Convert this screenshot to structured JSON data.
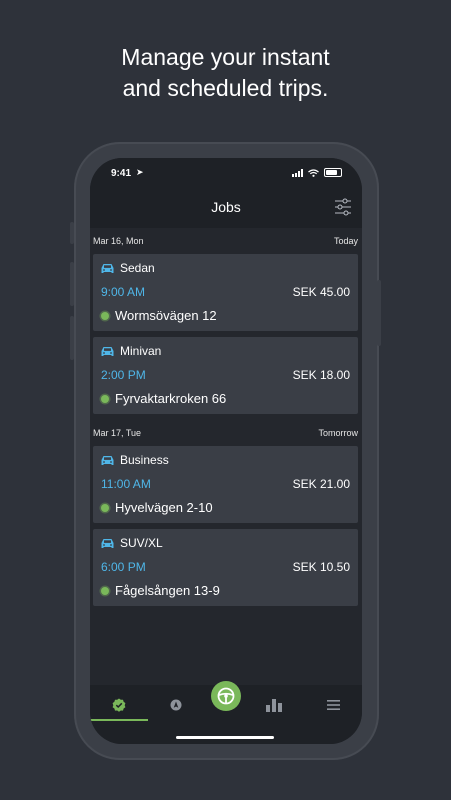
{
  "headline": {
    "line1": "Manage your instant",
    "line2": "and scheduled trips."
  },
  "status_bar": {
    "time": "9:41"
  },
  "nav": {
    "title": "Jobs"
  },
  "sections": [
    {
      "date": "Mar 16, Mon",
      "relative": "Today",
      "jobs": [
        {
          "vehicle": "Sedan",
          "time": "9:00 AM",
          "price": "SEK 45.00",
          "address": "Wormsövägen 12"
        },
        {
          "vehicle": "Minivan",
          "time": "2:00 PM",
          "price": "SEK 18.00",
          "address": "Fyrvaktarkroken 66"
        }
      ]
    },
    {
      "date": "Mar 17, Tue",
      "relative": "Tomorrow",
      "jobs": [
        {
          "vehicle": "Business",
          "time": "11:00 AM",
          "price": "SEK 21.00",
          "address": "Hyvelvägen 2-10"
        },
        {
          "vehicle": "SUV/XL",
          "time": "6:00 PM",
          "price": "SEK 10.50",
          "address": "Fågelsången 13-9"
        }
      ]
    }
  ],
  "tabs": [
    {
      "icon": "check-badge-icon",
      "active": true
    },
    {
      "icon": "navigation-icon",
      "active": false
    },
    {
      "icon": "steering-wheel-icon",
      "active": false
    },
    {
      "icon": "bar-chart-icon",
      "active": false
    },
    {
      "icon": "menu-icon",
      "active": false
    }
  ],
  "colors": {
    "background": "#2e323a",
    "accent_green": "#7ab85a",
    "time_blue": "#4fb6e8",
    "card": "#3a3e46"
  }
}
